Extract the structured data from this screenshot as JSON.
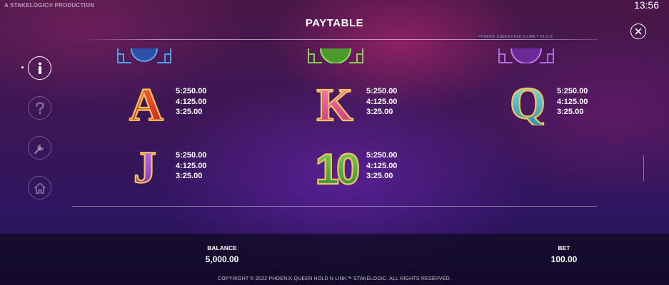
{
  "header": {
    "brand": "A STAKELOGIC® PRODUCTION",
    "clock": "13:56",
    "title": "PAYTABLE",
    "version": "PHOENIX QUEEN HOLD N LINK™ V1.0.11"
  },
  "sidebar": {
    "items": [
      {
        "name": "info",
        "icon": "info-icon",
        "active": true
      },
      {
        "name": "help",
        "icon": "question-icon",
        "active": false
      },
      {
        "name": "settings",
        "icon": "wrench-icon",
        "active": false
      },
      {
        "name": "home",
        "icon": "home-icon",
        "active": false
      }
    ]
  },
  "symbols": [
    {
      "letter": "A",
      "color": "#e0302a",
      "pays": [
        "5:250.00",
        "4:125.00",
        "3:25.00"
      ]
    },
    {
      "letter": "K",
      "color": "#e0428a",
      "pays": [
        "5:250.00",
        "4:125.00",
        "3:25.00"
      ]
    },
    {
      "letter": "Q",
      "color": "#3fb8c8",
      "pays": [
        "5:250.00",
        "4:125.00",
        "3:25.00"
      ]
    },
    {
      "letter": "J",
      "color": "#9a3fc8",
      "pays": [
        "5:250.00",
        "4:125.00",
        "3:25.00"
      ]
    },
    {
      "letter": "10",
      "color": "#3aa04a",
      "pays": [
        "5:250.00",
        "4:125.00",
        "3:25.00"
      ]
    }
  ],
  "top_symbol_colors": [
    "#3a7ad8",
    "#58b040",
    "#a048c8"
  ],
  "footer": {
    "balance_label": "BALANCE",
    "balance_value": "5,000.00",
    "bet_label": "BET",
    "bet_value": "100.00",
    "copyright": "COPYRIGHT © 2022 PHOENIX QUEEN HOLD N LINK™ STAKELOGIC. ALL RIGHTS RESERVED."
  }
}
